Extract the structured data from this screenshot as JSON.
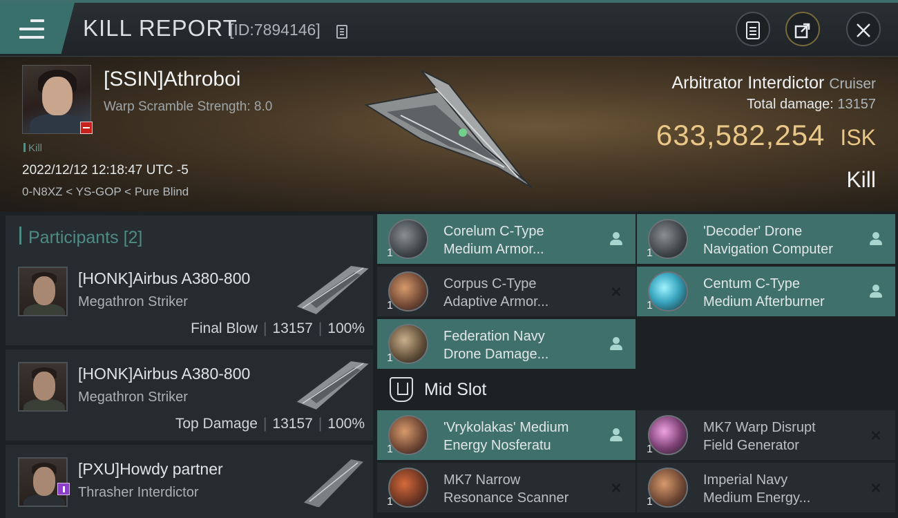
{
  "header": {
    "title": "KILL REPORT",
    "report_id": "[ID:7894146]",
    "menu_icon": "hamburger-icon",
    "buttons": [
      {
        "name": "clipboard",
        "icon": "clipboard-icon"
      },
      {
        "name": "share",
        "icon": "share-icon"
      },
      {
        "name": "close",
        "icon": "close-icon"
      }
    ]
  },
  "victim": {
    "name": "[SSIN]Athroboi",
    "warp_scramble": "Warp Scramble Strength: 8.0",
    "tag": "Kill",
    "datetime": "2022/12/12 12:18:47 UTC -5",
    "location": "0-N8XZ < YS-GOP < Pure Blind",
    "ship_name": "Arbitrator Interdictor",
    "ship_class": "Cruiser",
    "total_damage_label": "Total damage:",
    "total_damage": "13157",
    "isk_value": "633,582,254",
    "isk_unit": "ISK",
    "result": "Kill"
  },
  "participants": {
    "title": "Participants",
    "count": "[2]",
    "items": [
      {
        "name": "[HONK]Airbus A380-800",
        "ship": "Megathron Striker",
        "label": "Final Blow",
        "damage": "13157",
        "percent": "100%"
      },
      {
        "name": "[HONK]Airbus A380-800",
        "ship": "Megathron Striker",
        "label": "Top Damage",
        "damage": "13157",
        "percent": "100%"
      },
      {
        "name": "[PXU]Howdy partner",
        "ship": "Thrasher Interdictor"
      }
    ]
  },
  "modules": {
    "low_slots": [
      {
        "qty": "1",
        "line1": "Corelum C-Type",
        "line2": "Medium Armor...",
        "status": "dropped"
      },
      {
        "qty": "1",
        "line1": "'Decoder' Drone",
        "line2": "Navigation Computer",
        "status": "dropped"
      },
      {
        "qty": "1",
        "line1": "Corpus C-Type",
        "line2": "Adaptive Armor...",
        "status": "destroyed"
      },
      {
        "qty": "1",
        "line1": "Centum C-Type",
        "line2": "Medium Afterburner",
        "status": "dropped"
      },
      {
        "qty": "1",
        "line1": "Federation Navy",
        "line2": "Drone Damage...",
        "status": "dropped"
      }
    ],
    "mid_slot_title": "Mid Slot",
    "mid_slots": [
      {
        "qty": "1",
        "line1": "'Vrykolakas' Medium",
        "line2": "Energy Nosferatu",
        "status": "dropped"
      },
      {
        "qty": "1",
        "line1": "MK7 Warp Disrupt",
        "line2": "Field Generator",
        "status": "destroyed"
      },
      {
        "qty": "1",
        "line1": "MK7 Narrow",
        "line2": "Resonance Scanner",
        "status": "destroyed"
      },
      {
        "qty": "1",
        "line1": "Imperial Navy",
        "line2": "Medium Energy...",
        "status": "destroyed"
      }
    ]
  }
}
